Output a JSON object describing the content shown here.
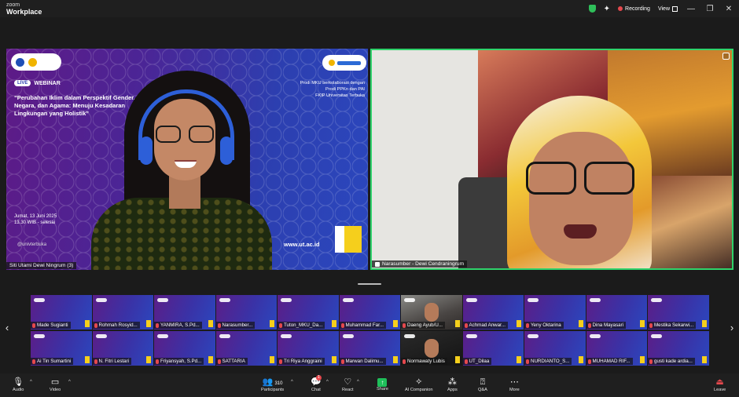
{
  "titlebar": {
    "brand_top": "zoom",
    "brand_bottom": "Workplace",
    "recording": "Recording",
    "view": "View",
    "minimize": "—",
    "maximize": "❐",
    "close": "✕"
  },
  "slide": {
    "live": "LIVE",
    "webinar": "WEBINAR",
    "title": "“Perubahan Iklim dalam Perspektif Gender, Negara, dan Agama: Menuju Kesadaran Lingkungan yang Holistik”",
    "collab_line1": "Prodi MKU berkolaborasi dengan",
    "collab_line2": "Prodi PPKn dan PAI",
    "collab_line3": "FKIP Universitas Terbuka",
    "date_line1": "Jumat, 13 Juni 2025",
    "date_line2": "13.30 WIB - selesai",
    "social": "@univterbuka",
    "url": "www.ut.ac.id",
    "speaker_name": "Siti Utami Dewi Ningrum (3)"
  },
  "right_tile": {
    "speaker_name": "Narasumber - Dewi Cendraningrum"
  },
  "gallery": {
    "prev": "‹",
    "next": "›",
    "participants": [
      {
        "name": "Made Sugianti",
        "type": "slide"
      },
      {
        "name": "Rohmah Rosyid...",
        "type": "slide"
      },
      {
        "name": "YANMIRA, S.Pd...",
        "type": "slide"
      },
      {
        "name": "Narasumber...",
        "type": "slide"
      },
      {
        "name": "Tuton_MKU_Da...",
        "type": "slide"
      },
      {
        "name": "Muhammad Far...",
        "type": "slide"
      },
      {
        "name": "Daeng Ayub/U...",
        "type": "cam"
      },
      {
        "name": "Achmad Anwar...",
        "type": "slide"
      },
      {
        "name": "Yeny Oktarina",
        "type": "slide"
      },
      {
        "name": "Dina Mayasari",
        "type": "slide"
      },
      {
        "name": "Mestika Sekarwi...",
        "type": "slide"
      },
      {
        "name": "Ai Tin Sumartini",
        "type": "slide"
      },
      {
        "name": "N. Fitri Lestari",
        "type": "slide"
      },
      {
        "name": "Friyansyah, S.Pd...",
        "type": "slide"
      },
      {
        "name": "SATTARIA",
        "type": "slide"
      },
      {
        "name": "Tri Riya Anggraini",
        "type": "slide"
      },
      {
        "name": "Marwan Dalimu...",
        "type": "slide"
      },
      {
        "name": "Normawaty Lubis",
        "type": "cam-dark"
      },
      {
        "name": "UT_Dilaa",
        "type": "slide"
      },
      {
        "name": "NURDIANTO_S...",
        "type": "slide"
      },
      {
        "name": "MUHAMAD RIF...",
        "type": "slide"
      },
      {
        "name": "gusti kade ardia...",
        "type": "slide"
      }
    ]
  },
  "toolbar": {
    "audio": "Audio",
    "video": "Video",
    "participants": "Participants",
    "participants_count": "310",
    "chat": "Chat",
    "chat_badge": "1",
    "react": "React",
    "share": "Share",
    "ai_companion": "AI Companion",
    "apps": "Apps",
    "qa": "Q&A",
    "more": "More",
    "leave": "Leave"
  },
  "colors": {
    "accent_green": "#2fd36b",
    "recording_red": "#e5484d",
    "share_green": "#1fbf5a",
    "toolbar_bg": "#1f1f1f"
  }
}
